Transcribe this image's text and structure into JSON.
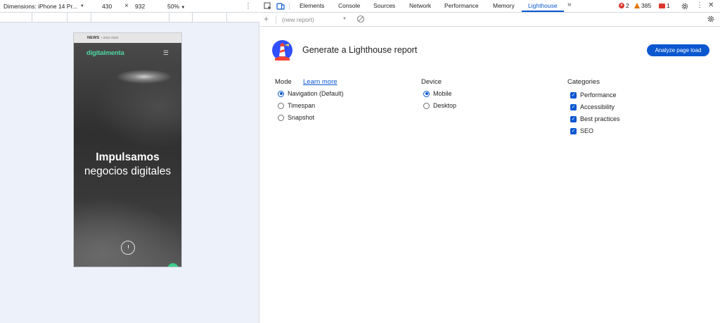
{
  "device_toolbar": {
    "dimensions_label": "Dimensions: iPhone 14 Pr...",
    "width": "430",
    "times": "×",
    "height": "932",
    "zoom": "50%",
    "more": "⋮"
  },
  "site": {
    "news_label": "NEWS",
    "news_date": "• 2024-2025",
    "logo": "digitalmenta",
    "menu_icon": "☰",
    "headline_bold": "Impulsamos",
    "headline_light": "negocios digitales"
  },
  "devtools": {
    "tabs": [
      {
        "label": "Elements",
        "active": false
      },
      {
        "label": "Console",
        "active": false
      },
      {
        "label": "Sources",
        "active": false
      },
      {
        "label": "Network",
        "active": false
      },
      {
        "label": "Performance",
        "active": false
      },
      {
        "label": "Memory",
        "active": false
      },
      {
        "label": "Lighthouse",
        "active": true
      }
    ],
    "more_tabs": "»",
    "errors_count": "2",
    "warnings_count": "385",
    "issues_count": "1",
    "settings_icon": "gear-icon",
    "kebab": "⋮",
    "close": "✕"
  },
  "lighthouse": {
    "report_select": "(new report)",
    "title": "Generate a Lighthouse report",
    "analyze_button": "Analyze page load",
    "mode": {
      "heading": "Mode",
      "learn_more": "Learn more",
      "options": [
        {
          "label": "Navigation (Default)",
          "selected": true
        },
        {
          "label": "Timespan",
          "selected": false
        },
        {
          "label": "Snapshot",
          "selected": false
        }
      ]
    },
    "device": {
      "heading": "Device",
      "options": [
        {
          "label": "Mobile",
          "selected": true
        },
        {
          "label": "Desktop",
          "selected": false
        }
      ]
    },
    "categories": {
      "heading": "Categories",
      "options": [
        {
          "label": "Performance",
          "checked": true
        },
        {
          "label": "Accessibility",
          "checked": true
        },
        {
          "label": "Best practices",
          "checked": true
        },
        {
          "label": "SEO",
          "checked": true
        }
      ]
    }
  },
  "colors": {
    "accent": "#0b57d0",
    "brand_green": "#4dd6a0",
    "error": "#dc362e",
    "warning": "#e37400"
  }
}
